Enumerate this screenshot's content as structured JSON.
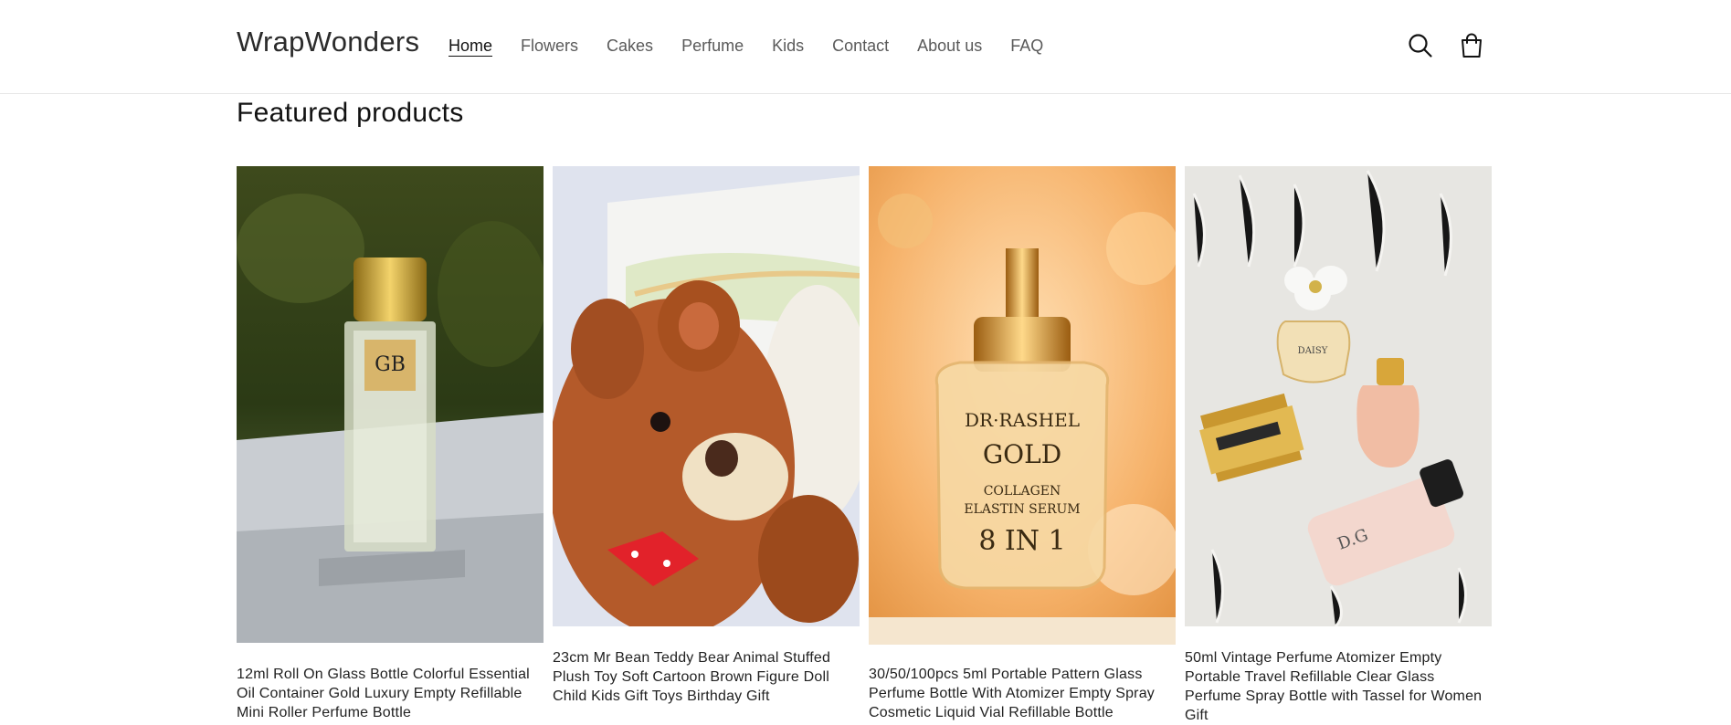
{
  "header": {
    "logo": "WrapWonders",
    "nav": [
      "Home",
      "Flowers",
      "Cakes",
      "Perfume",
      "Kids",
      "Contact",
      "About us",
      "FAQ"
    ],
    "icons": [
      "search-icon",
      "cart-icon"
    ]
  },
  "section": {
    "title": "Featured products"
  },
  "products": [
    {
      "title": "12ml Roll On Glass Bottle Colorful Essential Oil Container Gold Luxury Empty Refillable Mini Roller Perfume Bottle"
    },
    {
      "title": "23cm Mr Bean Teddy Bear Animal Stuffed Plush Toy Soft Cartoon Brown Figure Doll Child Kids Gift Toys Birthday Gift"
    },
    {
      "title": "30/50/100pcs 5ml Portable Pattern Glass Perfume Bottle With Atomizer Empty Spray Cosmetic Liquid Vial Refillable Bottle"
    },
    {
      "title": "50ml Vintage Perfume Atomizer Empty Portable Travel Refillable Clear Glass Perfume Spray Bottle with Tassel for Women Gift"
    }
  ],
  "colors": {
    "text": "#121212",
    "nav": "#5a5a5a",
    "border": "#e6e6e6",
    "background": "#ffffff"
  }
}
